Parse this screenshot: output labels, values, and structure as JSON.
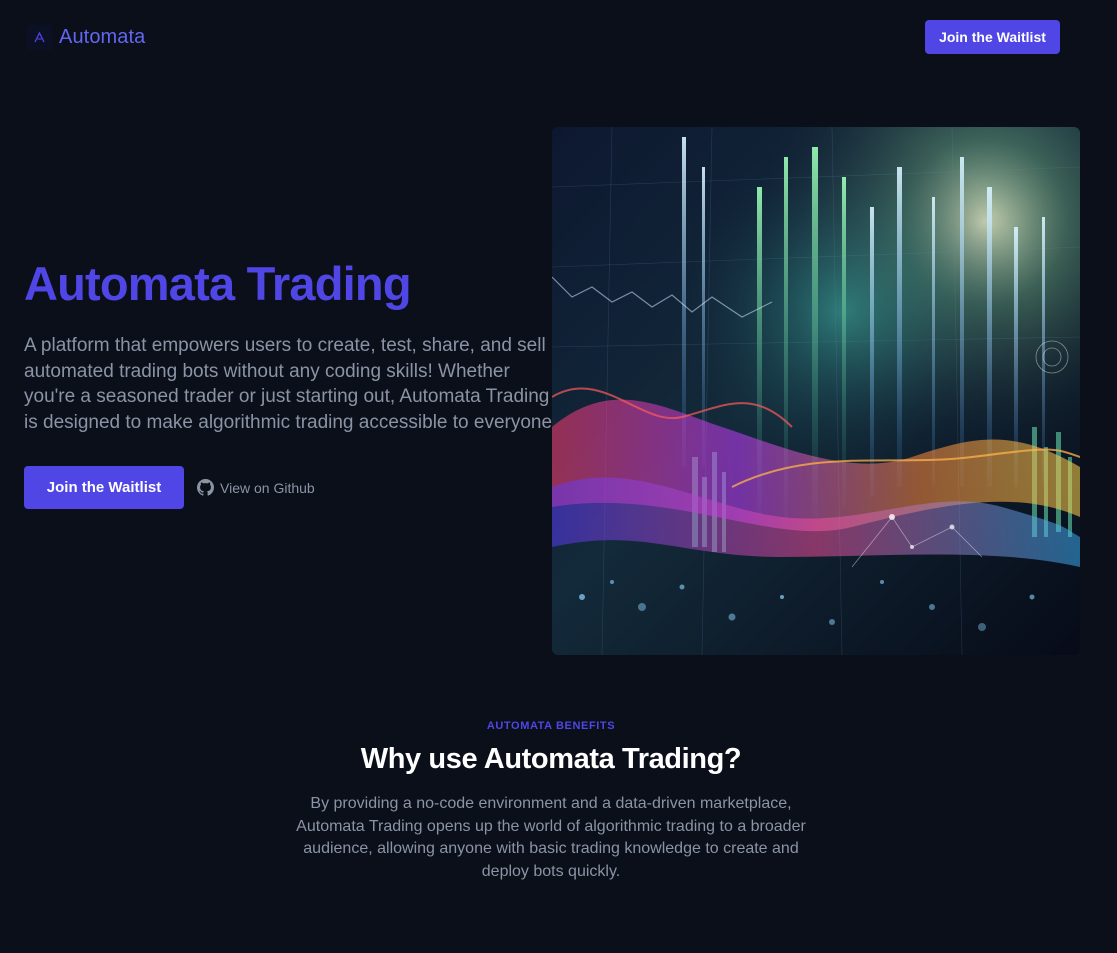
{
  "header": {
    "brand": "Automata",
    "cta_label": "Join the Waitlist"
  },
  "hero": {
    "title": "Automata Trading",
    "description": "A platform that empowers users to create, test, share, and sell automated trading bots without any coding skills! Whether you're a seasoned trader or just starting out, Automata Trading is designed to make algorithmic trading accessible to everyone.",
    "primary_cta": "Join the Waitlist",
    "github_label": "View on Github"
  },
  "benefits": {
    "eyebrow": "AUTOMATA BENEFITS",
    "title": "Why use Automata Trading?",
    "description": "By providing a no-code environment and a data-driven marketplace, Automata Trading opens up the world of algorithmic trading to a broader audience, allowing anyone with basic trading knowledge to create and deploy bots quickly."
  },
  "colors": {
    "background": "#0a0f1a",
    "accent": "#4f46e5",
    "muted_text": "#8b94a5"
  },
  "icons": {
    "logo": "automata-logo-icon",
    "github": "github-icon"
  }
}
